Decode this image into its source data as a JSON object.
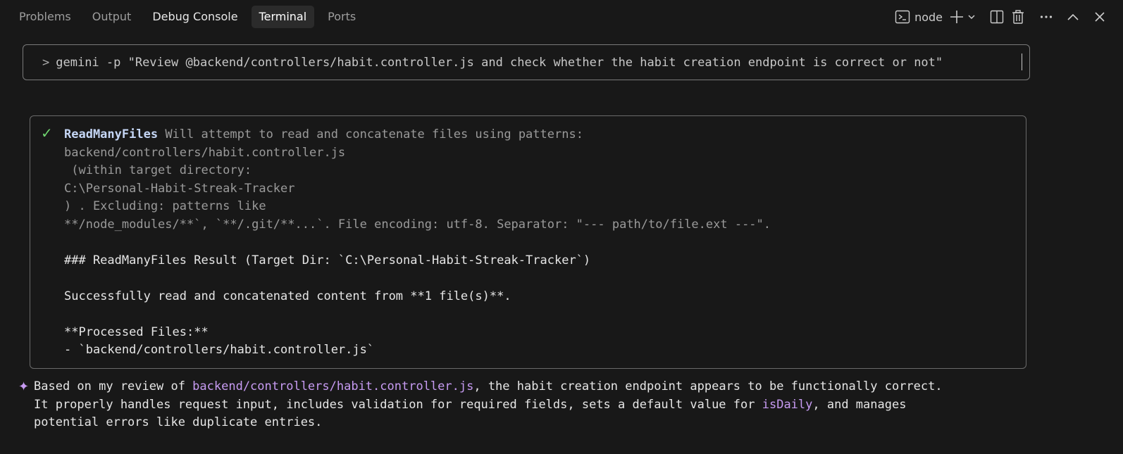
{
  "tabs": [
    {
      "label": "Problems"
    },
    {
      "label": "Output"
    },
    {
      "label": "Debug Console"
    },
    {
      "label": "Terminal"
    },
    {
      "label": "Ports"
    }
  ],
  "actions": {
    "shell_label": "node",
    "icons": [
      "terminal-icon",
      "plus-icon",
      "chevron-down-icon",
      "split-icon",
      "trash-icon",
      "more-icon",
      "chevron-up-icon",
      "close-icon"
    ]
  },
  "input": {
    "prompt_symbol": ">",
    "command": "gemini -p \"Review @backend/controllers/habit.controller.js and check whether the habit creation endpoint is correct or not\""
  },
  "tool_call": {
    "status_icon": "check-icon",
    "name": "ReadManyFiles",
    "description_1": "Will attempt to read and concatenate files using patterns:",
    "line_2": "backend/controllers/habit.controller.js",
    "line_3": " (within target directory:",
    "line_4": "C:\\Personal-Habit-Streak-Tracker",
    "line_5": ") . Excluding: patterns like",
    "line_6": "**/node_modules/**`, `**/.git/**...`. File encoding: utf-8. Separator: \"--- path/to/file.ext ---\".",
    "result_heading": "### ReadManyFiles Result (Target Dir: `C:\\Personal-Habit-Streak-Tracker`)",
    "result_summary": "Successfully read and concatenated content from **1 file(s)**.",
    "processed_heading": "**Processed Files:**",
    "processed_item": "- `backend/controllers/habit.controller.js`"
  },
  "response": {
    "icon": "sparkle-icon",
    "l1_a": "Based on my review of ",
    "l1_b": "backend/controllers/habit.controller.js",
    "l1_c": ", the habit creation endpoint appears to be functionally correct.",
    "l2_a": "It properly handles request input, includes validation for required fields, sets a default value for ",
    "l2_b": "isDaily",
    "l2_c": ", and manages",
    "l3": "potential errors like duplicate entries."
  },
  "colors": {
    "background": "#181818",
    "check": "#6fd46f",
    "accent_purple": "#c79bf2",
    "tool_name": "#c5d6f5"
  }
}
